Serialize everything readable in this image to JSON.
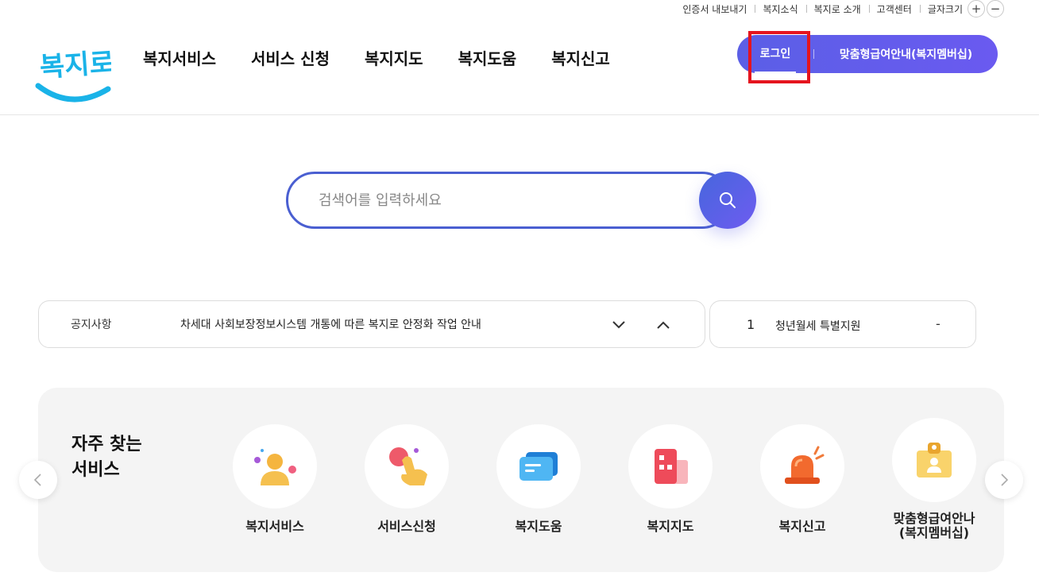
{
  "util": {
    "items": [
      "인증서 내보내기",
      "복지소식",
      "복지로 소개",
      "고객센터"
    ],
    "font_size_label": "글자크기",
    "plus": "+",
    "minus": "−"
  },
  "header": {
    "logo_text": "복지로",
    "nav": [
      "복지서비스",
      "서비스 신청",
      "복지지도",
      "복지도움",
      "복지신고"
    ],
    "login": "로그인",
    "membership": "맞춤형급여안내(복지멤버십)"
  },
  "search": {
    "placeholder": "검색어를 입력하세요"
  },
  "notice": {
    "label": "공지사항",
    "text": "차세대 사회보장정보시스템 개통에 따른 복지로 안정화 작업 안내"
  },
  "trending": {
    "rank": "1",
    "text": "청년월세 특별지원",
    "change": "-"
  },
  "services": {
    "title_line1": "자주 찾는",
    "title_line2": "서비스",
    "items": [
      {
        "label": "복지서비스",
        "icon": "person-icon"
      },
      {
        "label": "서비스신청",
        "icon": "hand-click-icon"
      },
      {
        "label": "복지도움",
        "icon": "chat-bubble-icon"
      },
      {
        "label": "복지지도",
        "icon": "building-icon"
      },
      {
        "label": "복지신고",
        "icon": "siren-icon"
      },
      {
        "label": "맞춤형급여안나\n(복지멤버십)",
        "icon": "id-card-icon"
      }
    ]
  },
  "colors": {
    "brand_gradient_start": "#5b5fe6",
    "brand_gradient_end": "#6a5af0",
    "search_border": "#4a5fd1",
    "highlight": "#e5141e",
    "logo_blue": "#1ab3e8"
  }
}
